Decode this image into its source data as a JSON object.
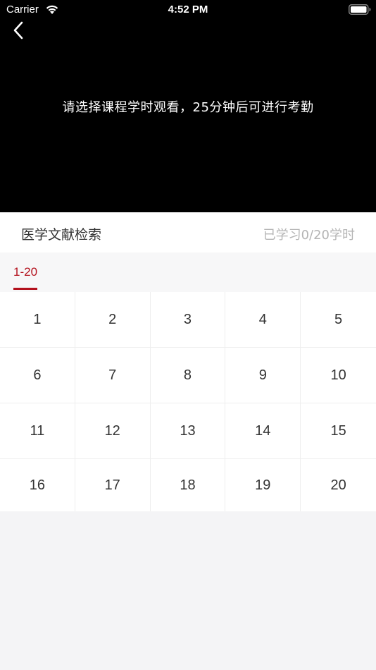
{
  "status_bar": {
    "carrier": "Carrier",
    "time": "4:52 PM",
    "wifi_icon": "wifi-icon",
    "battery_icon": "battery-icon"
  },
  "video": {
    "message": "请选择课程学时观看，25分钟后可进行考勤",
    "back_icon": "chevron-left-icon"
  },
  "course": {
    "title": "医学文献检索",
    "progress": "已学习0/20学时"
  },
  "tabs": [
    {
      "label": "1-20",
      "active": true
    }
  ],
  "lessons": [
    "1",
    "2",
    "3",
    "4",
    "5",
    "6",
    "7",
    "8",
    "9",
    "10",
    "11",
    "12",
    "13",
    "14",
    "15",
    "16",
    "17",
    "18",
    "19",
    "20"
  ],
  "colors": {
    "accent": "#b3111d",
    "video_bg": "#000000",
    "page_bg": "#f4f4f6",
    "muted_text": "#b4b4b4"
  }
}
